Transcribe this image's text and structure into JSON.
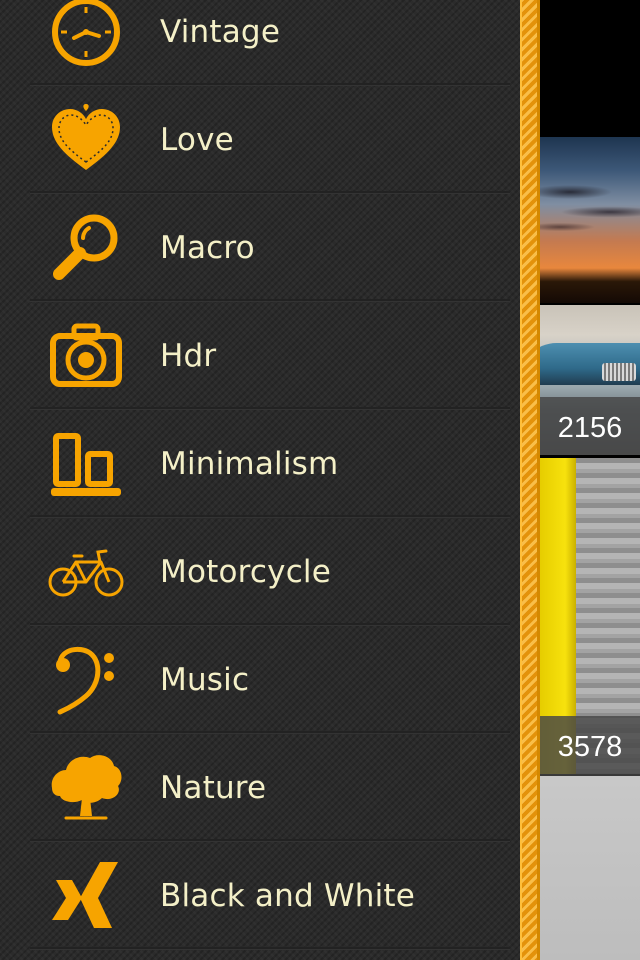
{
  "menu": {
    "items": [
      {
        "label": "Vintage",
        "icon": "clock-icon"
      },
      {
        "label": "Love",
        "icon": "heart-icon"
      },
      {
        "label": "Macro",
        "icon": "magnifier-icon"
      },
      {
        "label": "Hdr",
        "icon": "camera-icon"
      },
      {
        "label": "Minimalism",
        "icon": "bars-icon"
      },
      {
        "label": "Motorcycle",
        "icon": "bicycle-icon"
      },
      {
        "label": "Music",
        "icon": "bass-clef-icon"
      },
      {
        "label": "Nature",
        "icon": "tree-icon"
      },
      {
        "label": "Black and White",
        "icon": "xing-icon"
      }
    ]
  },
  "gallery": {
    "counts": [
      "2156",
      "3578"
    ]
  },
  "colors": {
    "accent": "#f7a400",
    "menu_bg": "#2b2b2b",
    "label_text": "#f4f0c8"
  }
}
